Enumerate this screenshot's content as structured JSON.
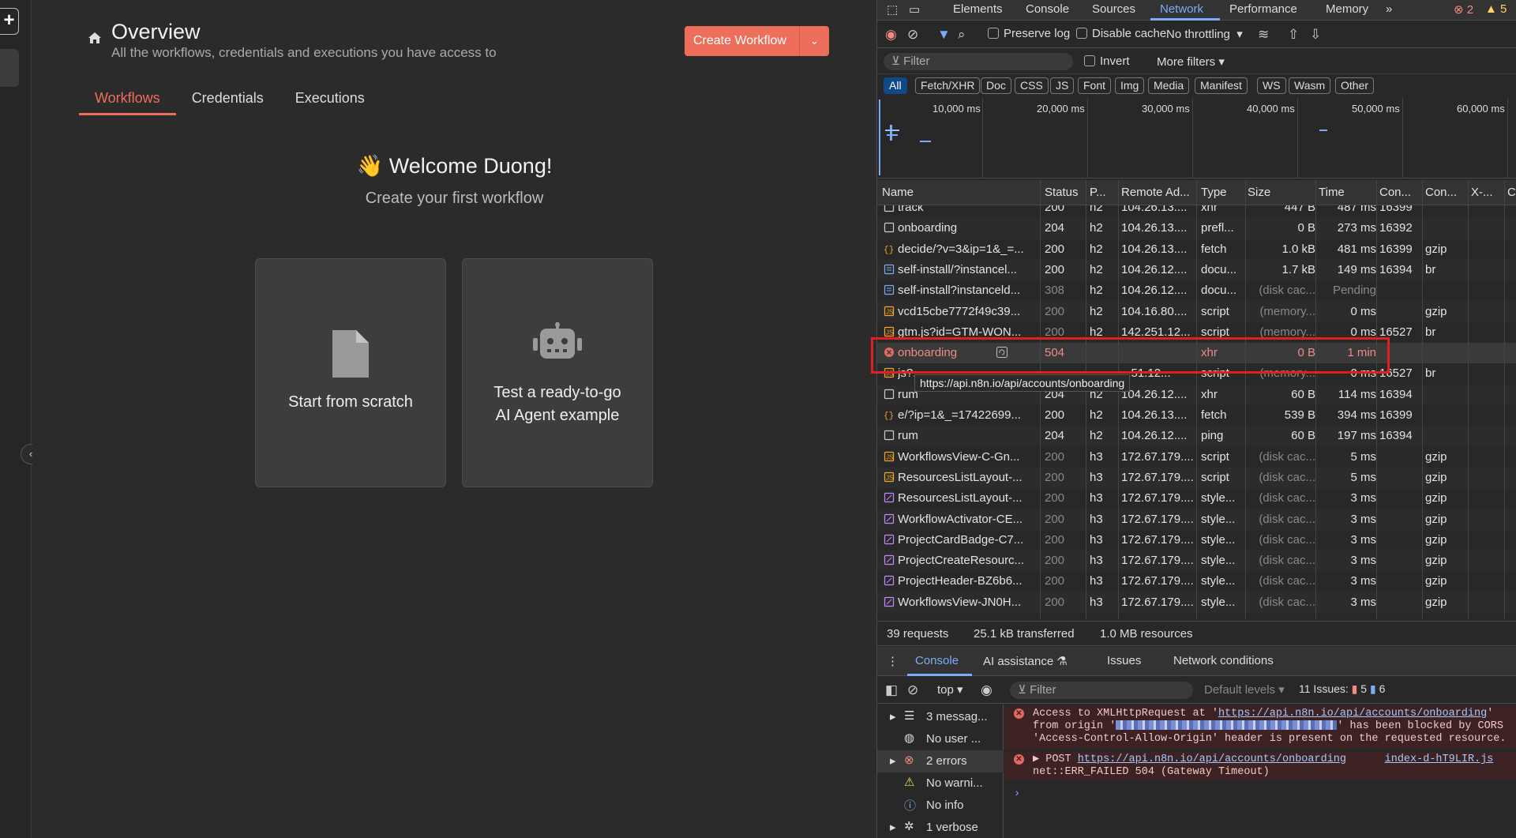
{
  "app": {
    "page_title": "Overview",
    "page_subtitle": "All the workflows, credentials and executions you have access to",
    "create_button": "Create Workflow",
    "tabs": [
      "Workflows",
      "Credentials",
      "Executions"
    ],
    "welcome": "👋 Welcome Duong!",
    "welcome_sub": "Create your first workflow",
    "card_scratch": "Start from scratch",
    "card_agent_line1": "Test a ready-to-go",
    "card_agent_line2": "AI Agent example",
    "accent_color": "#ec6e5b"
  },
  "devtools": {
    "tabs": [
      "Elements",
      "Console",
      "Sources",
      "Network",
      "Performance",
      "Memory"
    ],
    "active_tab": "Network",
    "error_count": "2",
    "warn_count": "5",
    "toolbar": {
      "preserve_log": "Preserve log",
      "disable_cache": "Disable cache",
      "throttling": "No throttling"
    },
    "filter": {
      "placeholder": "Filter",
      "invert": "Invert",
      "more_filters": "More filters"
    },
    "type_chips": [
      "All",
      "Fetch/XHR",
      "Doc",
      "CSS",
      "JS",
      "Font",
      "Img",
      "Media",
      "Manifest",
      "WS",
      "Wasm",
      "Other"
    ],
    "timeline_labels": [
      "10,000 ms",
      "20,000 ms",
      "30,000 ms",
      "40,000 ms",
      "50,000 ms",
      "60,000 ms"
    ],
    "columns": [
      "Name",
      "Status",
      "P...",
      "Remote Ad...",
      "Type",
      "Size",
      "Time",
      "Con...",
      "Con...",
      "X-...",
      "C"
    ],
    "rows": [
      {
        "icon": "doc-blank",
        "name": "track",
        "status": "200",
        "proto": "h2",
        "remote": "104.26.13....",
        "type": "xhr",
        "size": "447 B",
        "time": "487 ms",
        "con1": "16399",
        "con2": ""
      },
      {
        "icon": "doc-blank",
        "name": "onboarding",
        "status": "204",
        "proto": "h2",
        "remote": "104.26.13....",
        "type": "prefl...",
        "size": "0 B",
        "time": "273 ms",
        "con1": "16392",
        "con2": ""
      },
      {
        "icon": "fetch",
        "name": "decide/?v=3&ip=1&_=...",
        "status": "200",
        "proto": "h2",
        "remote": "104.26.13....",
        "type": "fetch",
        "size": "1.0 kB",
        "time": "481 ms",
        "con1": "16399",
        "con2": "gzip"
      },
      {
        "icon": "doc",
        "name": "self-install/?instancel...",
        "status": "200",
        "proto": "h2",
        "remote": "104.26.12....",
        "type": "docu...",
        "size": "1.7 kB",
        "time": "149 ms",
        "con1": "16394",
        "con2": "br"
      },
      {
        "icon": "doc",
        "name": "self-install?instanceld...",
        "status": "308",
        "proto": "h2",
        "remote": "104.26.12....",
        "type": "docu...",
        "size": "(disk cac...",
        "time": "Pending",
        "con1": "",
        "con2": "",
        "dim": true
      },
      {
        "icon": "script",
        "name": "vcd15cbe7772f49c39...",
        "status": "200",
        "proto": "h2",
        "remote": "104.16.80....",
        "type": "script",
        "size": "(memory...",
        "time": "0 ms",
        "con1": "",
        "con2": "gzip"
      },
      {
        "icon": "script",
        "name": "gtm.js?id=GTM-WON...",
        "status": "200",
        "proto": "h2",
        "remote": "142.251.12...",
        "type": "script",
        "size": "(memory...",
        "time": "0 ms",
        "con1": "16527",
        "con2": "br"
      },
      {
        "icon": "error",
        "name": "onboarding",
        "status": "504",
        "proto": "",
        "remote": "",
        "type": "xhr",
        "size": "0 B",
        "time": "1 min",
        "con1": "",
        "con2": "",
        "error": true
      },
      {
        "icon": "script",
        "name": "js?...",
        "status": "",
        "proto": "",
        "remote": "...51.12...",
        "type": "script",
        "size": "(memory...",
        "time": "0 ms",
        "con1": "16527",
        "con2": "br"
      },
      {
        "icon": "doc-blank",
        "name": "rum",
        "status": "204",
        "proto": "h2",
        "remote": "104.26.12....",
        "type": "xhr",
        "size": "60 B",
        "time": "114 ms",
        "con1": "16394",
        "con2": ""
      },
      {
        "icon": "fetch",
        "name": "e/?ip=1&_=17422699...",
        "status": "200",
        "proto": "h2",
        "remote": "104.26.13....",
        "type": "fetch",
        "size": "539 B",
        "time": "394 ms",
        "con1": "16399",
        "con2": ""
      },
      {
        "icon": "doc-blank",
        "name": "rum",
        "status": "204",
        "proto": "h2",
        "remote": "104.26.12....",
        "type": "ping",
        "size": "60 B",
        "time": "197 ms",
        "con1": "16394",
        "con2": ""
      },
      {
        "icon": "script",
        "name": "WorkflowsView-C-Gn...",
        "status": "200",
        "proto": "h3",
        "remote": "172.67.179....",
        "type": "script",
        "size": "(disk cac...",
        "time": "5 ms",
        "con1": "",
        "con2": "gzip"
      },
      {
        "icon": "script",
        "name": "ResourcesListLayout-...",
        "status": "200",
        "proto": "h3",
        "remote": "172.67.179....",
        "type": "script",
        "size": "(disk cac...",
        "time": "5 ms",
        "con1": "",
        "con2": "gzip"
      },
      {
        "icon": "style",
        "name": "ResourcesListLayout-...",
        "status": "200",
        "proto": "h3",
        "remote": "172.67.179....",
        "type": "style...",
        "size": "(disk cac...",
        "time": "3 ms",
        "con1": "",
        "con2": "gzip"
      },
      {
        "icon": "style",
        "name": "WorkflowActivator-CE...",
        "status": "200",
        "proto": "h3",
        "remote": "172.67.179....",
        "type": "style...",
        "size": "(disk cac...",
        "time": "3 ms",
        "con1": "",
        "con2": "gzip"
      },
      {
        "icon": "style",
        "name": "ProjectCardBadge-C7...",
        "status": "200",
        "proto": "h3",
        "remote": "172.67.179....",
        "type": "style...",
        "size": "(disk cac...",
        "time": "3 ms",
        "con1": "",
        "con2": "gzip"
      },
      {
        "icon": "style",
        "name": "ProjectCreateResourc...",
        "status": "200",
        "proto": "h3",
        "remote": "172.67.179....",
        "type": "style...",
        "size": "(disk cac...",
        "time": "3 ms",
        "con1": "",
        "con2": "gzip"
      },
      {
        "icon": "style",
        "name": "ProjectHeader-BZ6b6...",
        "status": "200",
        "proto": "h3",
        "remote": "172.67.179....",
        "type": "style...",
        "size": "(disk cac...",
        "time": "3 ms",
        "con1": "",
        "con2": "gzip"
      },
      {
        "icon": "style",
        "name": "WorkflowsView-JN0H...",
        "status": "200",
        "proto": "h3",
        "remote": "172.67.179....",
        "type": "style...",
        "size": "(disk cac...",
        "time": "3 ms",
        "con1": "",
        "con2": "gzip"
      }
    ],
    "tooltip": "https://api.n8n.io/api/accounts/onboarding",
    "summary": [
      "39 requests",
      "25.1 kB transferred",
      "1.0 MB resources"
    ],
    "drawer_tabs": [
      "Console",
      "AI assistance",
      "Issues",
      "Network conditions"
    ],
    "console_toolbar": {
      "context": "top",
      "filter": "Filter",
      "levels": "Default levels",
      "issues": "11 Issues:",
      "issues_err": "5",
      "issues_info": "6"
    },
    "console_side": [
      "3 messag...",
      "No user ...",
      "2 errors",
      "No warni...",
      "No info",
      "1 verbose"
    ],
    "console_msgs": {
      "m1_a": "Access to XMLHttpRequest at '",
      "m1_link": "https://api.n8n.io/api/accounts/onboarding",
      "m1_b": "'",
      "m1_c": "from origin '",
      "m1_d": "' has been blocked by CORS",
      "m1_e": "'Access-Control-Allow-Origin' header is present on the requested resource.",
      "m2_a": "▶ POST ",
      "m2_link": "https://api.n8n.io/api/accounts/onboarding",
      "m2_src": "index-d-hT9LIR.js",
      "m2_b": "net::ERR_FAILED 504 (Gateway Timeout)"
    }
  }
}
